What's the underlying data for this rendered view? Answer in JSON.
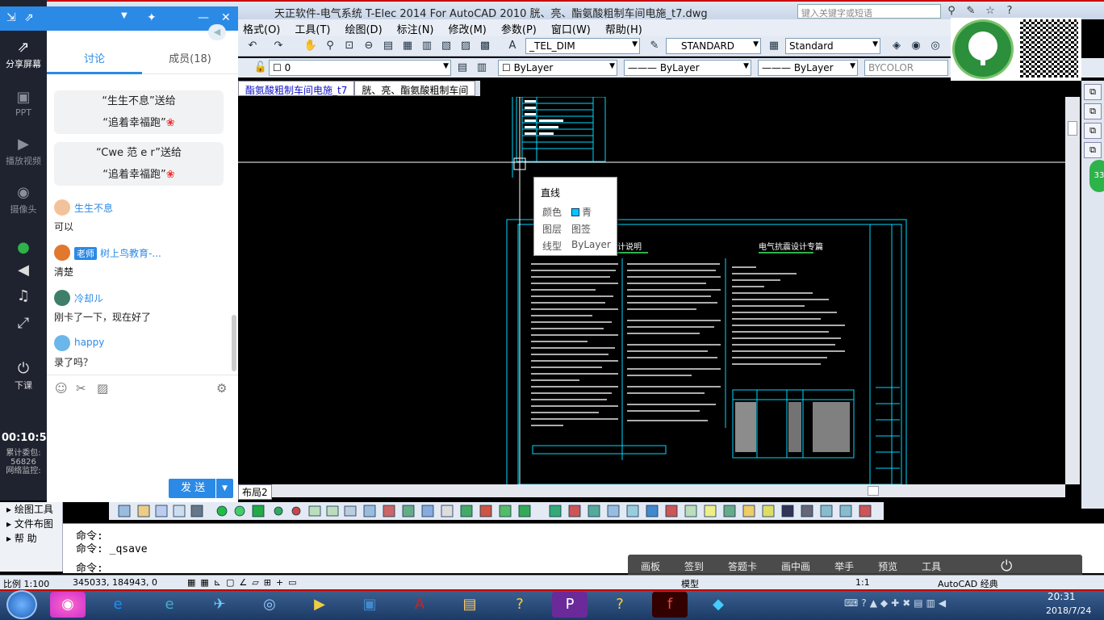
{
  "window": {
    "title": "天正软件-电气系统 T-Elec 2014  For AutoCAD 2010    胱、亮、酯氨酸粗制车间电施_t7.dwg",
    "search_placeholder": "键入关键字或短语"
  },
  "menubar": [
    "格式(O)",
    "工具(T)",
    "绘图(D)",
    "标注(N)",
    "修改(M)",
    "参数(P)",
    "窗口(W)",
    "帮助(H)"
  ],
  "toolbar": {
    "dimstyle": "_TEL_DIM",
    "textstyle": "STANDARD",
    "tablestyle": "Standard",
    "layer": "0",
    "color": "ByLayer",
    "linetype": "ByLayer",
    "lineweight": "ByLayer",
    "plotstyle": "BYCOLOR"
  },
  "file_tabs": [
    "酯氨酸粗制车间电施_t7",
    "胱、亮、酯氨酸粗制车间"
  ],
  "layout_tab": "布局2",
  "tooltip": {
    "title": "直线",
    "rows": [
      {
        "label": "颜色",
        "value": "青"
      },
      {
        "label": "图层",
        "value": "图签"
      },
      {
        "label": "线型",
        "value": "ByLayer"
      }
    ]
  },
  "drawing": {
    "heading_left": "计说明",
    "heading_right": "电气抗震设计专篇"
  },
  "left_panel": [
    "绘图工具",
    "文件布图",
    "帮    助"
  ],
  "command_lines": [
    "命令:",
    "命令: _qsave",
    "命令:"
  ],
  "status": {
    "scale": "比例 1:100",
    "coords": "345033, 184943, 0",
    "model": "模型",
    "annot_scale": "1:1",
    "workspace": "AutoCAD 经典"
  },
  "classbar": [
    "画板",
    "签到",
    "答题卡",
    "画中画",
    "举手",
    "预览",
    "工具"
  ],
  "taskbar": {
    "time": "20:31",
    "date": "2018/7/24"
  },
  "qq": {
    "left_items": [
      "分享屏幕",
      "PPT",
      "播放视频",
      "摄像头",
      "下课"
    ],
    "timer": "00:10:57",
    "gift_stat": [
      "累计委包:",
      "56826",
      "网络监控:"
    ],
    "tabs": [
      "讨论",
      "成员(18)"
    ],
    "gifts": [
      {
        "line1": "“生生不息”送给",
        "line2": "“追着幸福跑”"
      },
      {
        "line1": "“Cwe 范 e r”送给",
        "line2": "“追着幸福跑”"
      }
    ],
    "messages": [
      {
        "name": "生生不息",
        "text": "可以",
        "teacher": ""
      },
      {
        "name": "树上鸟教育-...",
        "text": "清楚",
        "teacher": "老师"
      },
      {
        "name": "冷却ル",
        "text": "刚卡了一下，现在好了",
        "teacher": ""
      },
      {
        "name": "happy",
        "text": "录了吗？",
        "teacher": ""
      }
    ],
    "send_label": "发 送"
  },
  "colors": {
    "cyan": "#00d8ff",
    "qq_blue": "#2b8ae6",
    "accent_red": "#cc0000"
  }
}
